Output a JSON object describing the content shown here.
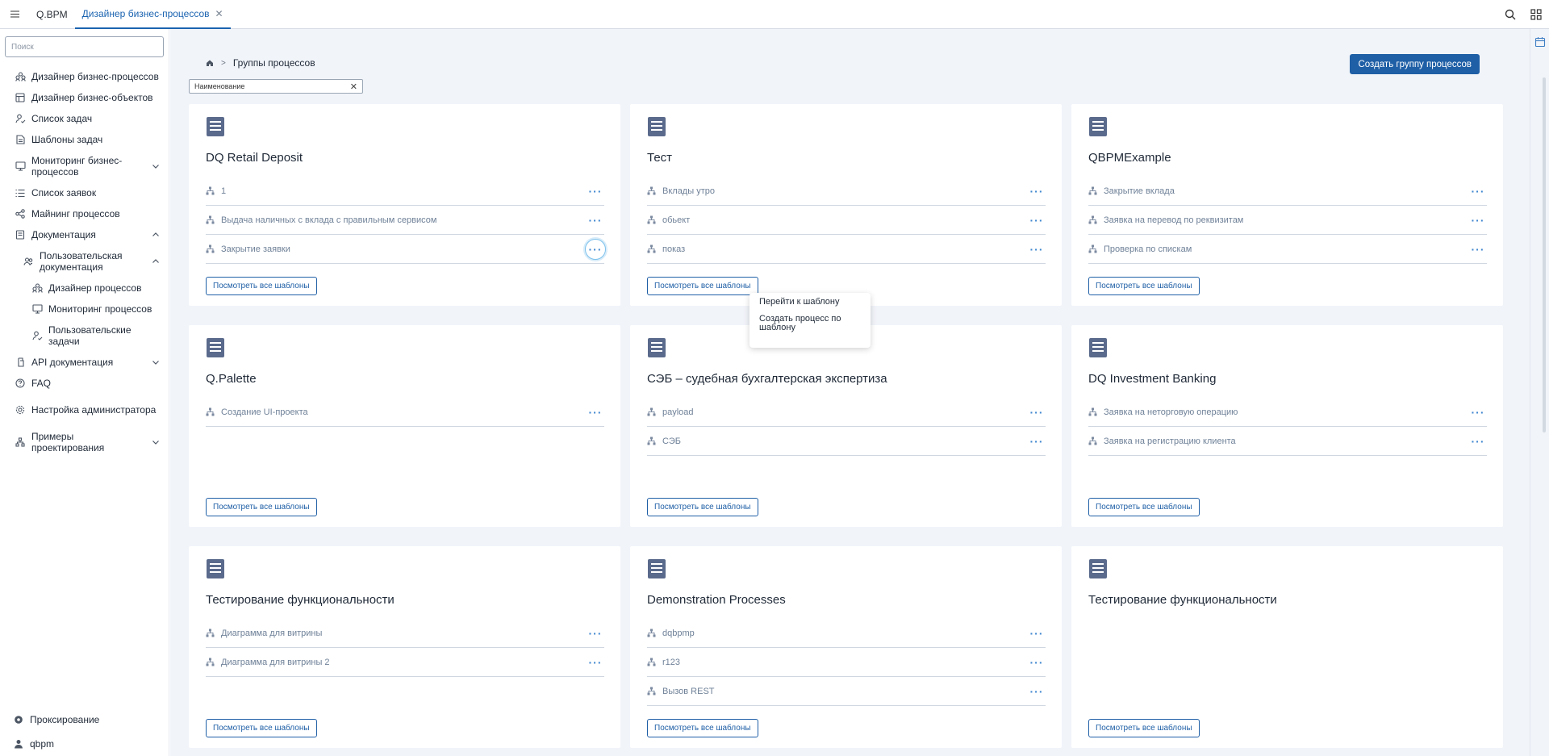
{
  "topbar": {
    "tabs": [
      {
        "label": "Q.BPM"
      },
      {
        "label": "Дизайнер бизнес-процессов"
      }
    ]
  },
  "sidebar": {
    "search_placeholder": "Поиск",
    "items": [
      {
        "label": "Дизайнер бизнес-процессов",
        "icon": "people-group-icon"
      },
      {
        "label": "Дизайнер бизнес-объектов",
        "icon": "table-icon"
      },
      {
        "label": "Список задач",
        "icon": "user-task-icon"
      },
      {
        "label": "Шаблоны задач",
        "icon": "document-icon"
      },
      {
        "label": "Мониторинг бизнес-процессов",
        "icon": "monitor-icon"
      },
      {
        "label": "Список заявок",
        "icon": "list-icon"
      },
      {
        "label": "Майнинг процессов",
        "icon": "share-icon"
      },
      {
        "label": "Документация",
        "icon": "book-icon"
      },
      {
        "label": "Пользовательская документация",
        "icon": "users-icon"
      },
      {
        "label": "Дизайнер процессов",
        "icon": "people-group-icon"
      },
      {
        "label": "Мониторинг процессов",
        "icon": "monitor-icon"
      },
      {
        "label": "Пользовательские задачи",
        "icon": "user-task-icon"
      },
      {
        "label": "API документация",
        "icon": "api-icon"
      },
      {
        "label": "FAQ",
        "icon": "question-icon"
      },
      {
        "label": "Настройка администратора",
        "icon": "gear-icon"
      },
      {
        "label": "Примеры проектирования",
        "icon": "hierarchy-icon"
      }
    ],
    "bottom": [
      {
        "label": "Проксирование",
        "icon": "gear-icon"
      },
      {
        "label": "qbpm",
        "icon": "user-icon"
      }
    ]
  },
  "main": {
    "breadcrumb": "Группы процессов",
    "create_button": "Создать группу процессов",
    "filter_chip": "Наименование",
    "view_all_label": "Посмотреть все шаблоны",
    "cards": [
      {
        "title": "DQ Retail Deposit",
        "rows": [
          "1",
          "Выдача наличных с вклада с правильным сервисом",
          "Закрытие заявки"
        ]
      },
      {
        "title": "Тест",
        "rows": [
          "Вклады утро",
          "обьект",
          "показ"
        ]
      },
      {
        "title": "QBPMExample",
        "rows": [
          "Закрытие вклада",
          "Заявка на перевод по реквизитам",
          "Проверка по спискам"
        ]
      },
      {
        "title": "Q.Palette",
        "rows": [
          "Создание UI-проекта"
        ]
      },
      {
        "title": "СЭБ – судебная бухгалтерская экспертиза",
        "rows": [
          "payload",
          "СЭБ"
        ]
      },
      {
        "title": "DQ Investment Banking",
        "rows": [
          "Заявка на неторговую операцию",
          "Заявка на регистрацию клиента"
        ]
      },
      {
        "title": "Тестирование функциональности",
        "rows": [
          "Диаграмма для витрины",
          "Диаграмма для витрины 2"
        ]
      },
      {
        "title": "Demonstration Processes",
        "rows": [
          "dqbpmp",
          "r123",
          "Вызов REST"
        ]
      },
      {
        "title": "Тестирование функциональности",
        "rows": []
      }
    ],
    "context_menu": {
      "items": [
        "Перейти к шаблону",
        "Создать процесс по шаблону"
      ]
    }
  },
  "colors": {
    "accent": "#1f5fa6",
    "background": "#f1f4f9",
    "row_text": "#6f8198"
  }
}
